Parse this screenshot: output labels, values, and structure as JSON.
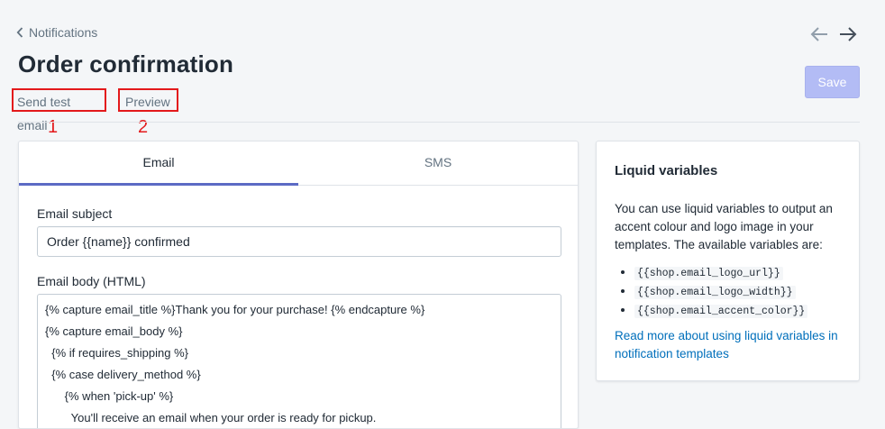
{
  "breadcrumb": {
    "label": "Notifications"
  },
  "page": {
    "title": "Order confirmation"
  },
  "actions": {
    "send_test": "Send test email",
    "preview": "Preview",
    "save": "Save"
  },
  "markers": {
    "one": "1",
    "two": "2"
  },
  "tabs": [
    {
      "label": "Email",
      "active": true
    },
    {
      "label": "SMS",
      "active": false
    }
  ],
  "email": {
    "subject_label": "Email subject",
    "subject_value": "Order {{name}} confirmed",
    "body_label": "Email body (HTML)",
    "body_lines": [
      "{% capture email_title %}Thank you for your purchase! {% endcapture %}",
      "{% capture email_body %}",
      "  {% if requires_shipping %}",
      "  {% case delivery_method %}",
      "      {% when 'pick-up' %}",
      "        You'll receive an email when your order is ready for pickup."
    ]
  },
  "liquid": {
    "title": "Liquid variables",
    "description": "You can use liquid variables to output an accent colour and logo image in your templates. The available variables are:",
    "variables": [
      "{{shop.email_logo_url}}",
      "{{shop.email_logo_width}}",
      "{{shop.email_accent_color}}"
    ],
    "link": "Read more about using liquid variables in notification templates"
  },
  "colors": {
    "accent": "#5c6ac4",
    "save_disabled": "#b3bcf5",
    "link": "#006fbb",
    "marker": "#e3191b"
  },
  "icons": {
    "back": "chevron-left-icon",
    "prev": "arrow-left-icon",
    "next": "arrow-right-icon"
  }
}
